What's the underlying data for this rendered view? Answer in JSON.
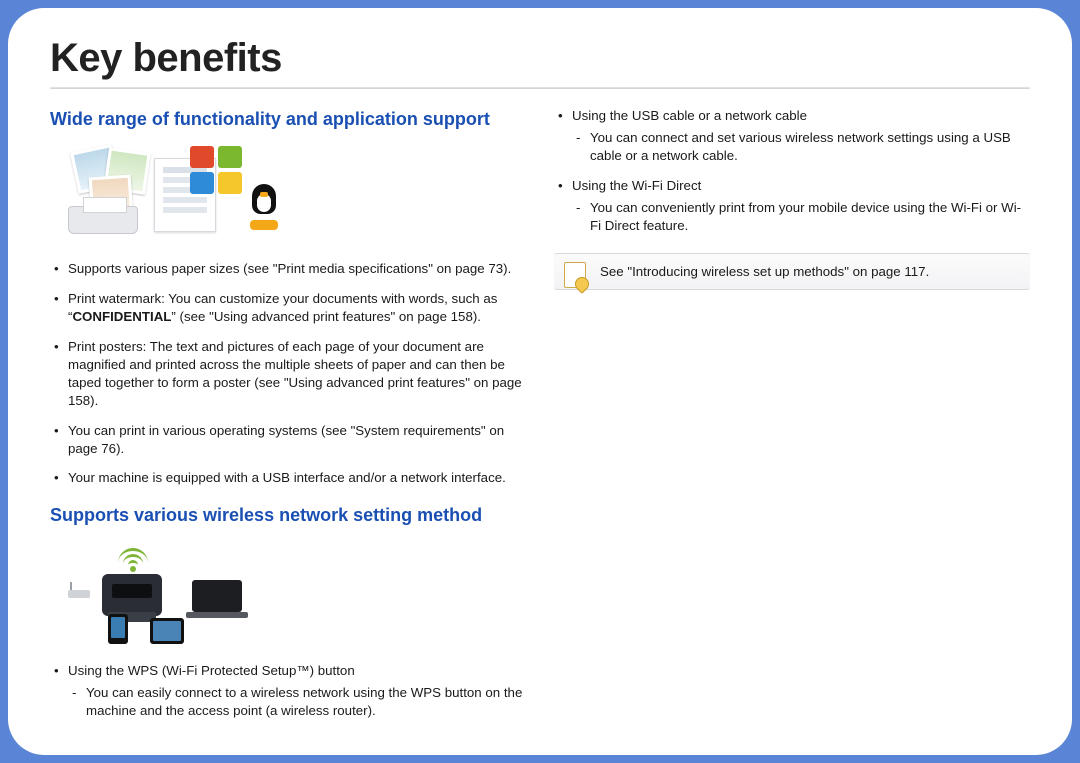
{
  "title": "Key benefits",
  "left": {
    "section1_heading": "Wide range of functionality and application support",
    "bullets1": {
      "b0": "Supports various paper sizes (see \"Print media specifications\" on page 73).",
      "b1_pre": "Print watermark: You can customize your documents with words, such as “",
      "b1_strong": "CONFIDENTIAL",
      "b1_post": "” (see \"Using advanced print features\" on page 158).",
      "b2": "Print posters: The text and pictures of each page of your document are magnified and printed across the multiple sheets of paper and can then be taped together to form a poster (see \"Using advanced print features\" on page 158).",
      "b3": "You can print in various operating systems (see \"System requirements\" on page 76).",
      "b4": "Your machine is equipped with a USB interface and/or a network interface."
    },
    "section2_heading": "Supports various wireless network setting method",
    "bullets2": {
      "b0": "Using the WPS (Wi-Fi Protected Setup™) button",
      "b0_sub0": "You can easily connect to a wireless network using the WPS button on the machine and the access point (a wireless router)."
    }
  },
  "right": {
    "bullets": {
      "b0": "Using the USB cable or a network cable",
      "b0_sub0": "You can connect and set various wireless network settings using a USB cable or a network cable.",
      "b1": "Using the Wi-Fi Direct",
      "b1_sub0": "You can conveniently print from your mobile device using the Wi-Fi or Wi-Fi Direct feature."
    },
    "note": "See \"Introducing wireless set up methods\" on page 117."
  },
  "icons": {
    "os_windows": "windows-logo-icon",
    "os_linux": "linux-tux-icon",
    "wifi": "wifi-icon",
    "note": "note-pencil-icon"
  }
}
